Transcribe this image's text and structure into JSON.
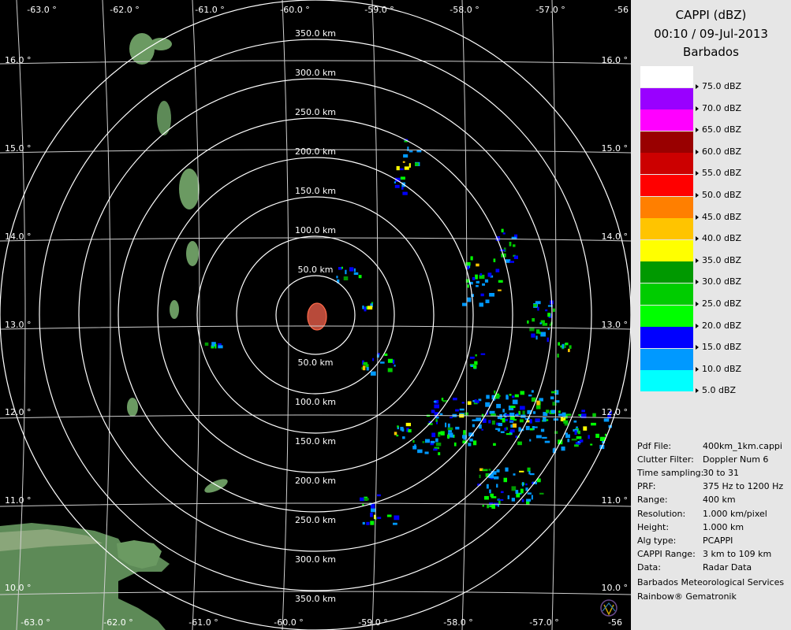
{
  "header": {
    "product": "CAPPI (dBZ)",
    "datetime": "00:10 / 09-Jul-2013",
    "site": "Barbados"
  },
  "legend": [
    {
      "label": "75.0 dBZ",
      "color": "#ffffff"
    },
    {
      "label": "70.0 dBZ",
      "color": "#9900ff"
    },
    {
      "label": "65.0 dBZ",
      "color": "#ff00ff"
    },
    {
      "label": "60.0 dBZ",
      "color": "#990000"
    },
    {
      "label": "55.0 dBZ",
      "color": "#cc0000"
    },
    {
      "label": "50.0 dBZ",
      "color": "#ff0000"
    },
    {
      "label": "45.0 dBZ",
      "color": "#ff7f00"
    },
    {
      "label": "40.0 dBZ",
      "color": "#ffc400"
    },
    {
      "label": "35.0 dBZ",
      "color": "#ffff00"
    },
    {
      "label": "30.0 dBZ",
      "color": "#009900"
    },
    {
      "label": "25.0 dBZ",
      "color": "#00cc00"
    },
    {
      "label": "20.0 dBZ",
      "color": "#00ff00"
    },
    {
      "label": "15.0 dBZ",
      "color": "#0000ff"
    },
    {
      "label": "10.0 dBZ",
      "color": "#0099ff"
    },
    {
      "label": "5.0 dBZ",
      "color": "#00ffff"
    }
  ],
  "info": [
    {
      "key": "Pdf File:",
      "value": "400km_1km.cappi"
    },
    {
      "key": "Clutter Filter:",
      "value": "Doppler Num 6"
    },
    {
      "key": "Time sampling:",
      "value": "30 to 31"
    },
    {
      "key": "PRF:",
      "value": "375 Hz to 1200 Hz"
    },
    {
      "key": "Range:",
      "value": "400 km"
    },
    {
      "key": "Resolution:",
      "value": "1.000 km/pixel"
    },
    {
      "key": "Height:",
      "value": "1.000 km"
    },
    {
      "key": "Alg type:",
      "value": "PCAPPI"
    },
    {
      "key": "CAPPI Range:",
      "value": "3 km to 109 km"
    },
    {
      "key": "Data:",
      "value": "Radar Data"
    }
  ],
  "footer": {
    "organization": "Barbados Meteorological Services",
    "software": "Rainbow® Gematronik"
  },
  "map": {
    "longitude_labels": [
      "-63.0 °",
      "-62.0 °",
      "-61.0 °",
      "-60.0 °",
      "-59.0 °",
      "-58.0 °",
      "-57.0 °",
      "-56"
    ],
    "latitude_labels": [
      "16.0 °",
      "15.0 °",
      "14.0 °",
      "13.0 °",
      "12.0 °",
      "11.0 °",
      "10.0 °"
    ],
    "range_labels_north": [
      "50.0 km",
      "100.0 km",
      "150.0 km",
      "200.0 km",
      "250.0 km",
      "300.0 km",
      "350.0 km"
    ],
    "range_labels_south": [
      "50.0 km",
      "100.0 km",
      "150.0 km",
      "200.0 km",
      "250.0 km",
      "300.0 km",
      "350.0 km"
    ],
    "ring_color": "#ffffff",
    "land_color": "#4f7a4a",
    "radar_color": "#7a3a3a"
  }
}
